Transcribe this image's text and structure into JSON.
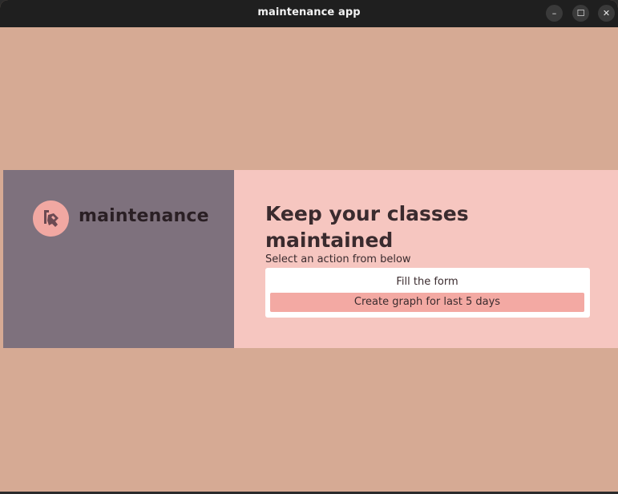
{
  "window": {
    "title": "maintenance app",
    "controls": {
      "minimize": "–",
      "maximize": "☐",
      "close": "✕"
    }
  },
  "brand": {
    "name": "maintenance",
    "logo_icon": "carpentry-icon"
  },
  "main": {
    "headline": "Keep your classes maintained",
    "subheadline": "Select an action from below",
    "actions": [
      {
        "label": "Fill the form"
      },
      {
        "label": "Create graph for last 5 days"
      }
    ]
  },
  "colors": {
    "background": "#d6aa94",
    "left_panel": "#7e717d",
    "right_panel": "#f6c6c0",
    "accent": "#f3a9a3",
    "titlebar": "#1f1f1f"
  }
}
